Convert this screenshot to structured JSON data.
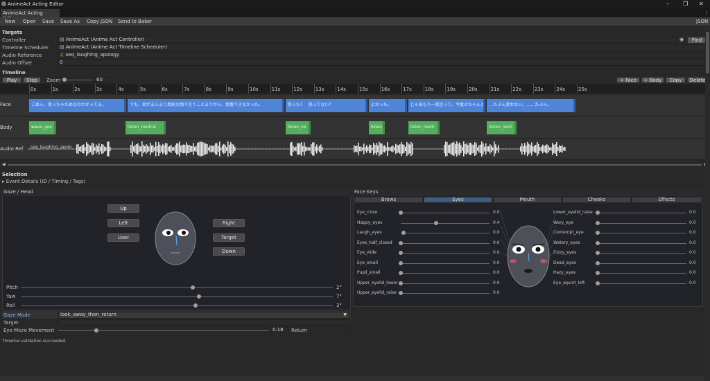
{
  "window": {
    "title": "AnimeAct Acting Editor",
    "tab": "AnimeAct Acting Editor",
    "json_label": "JSON"
  },
  "toolbar": {
    "items": [
      "New",
      "Open",
      "Save",
      "Save As",
      "Copy JSON",
      "Send to Baker"
    ]
  },
  "targets": {
    "header": "Targets",
    "controller_label": "Controller",
    "controller_value": "AnimeAct (Anime Act Controller)",
    "scheduler_label": "Timeline Scheduler",
    "scheduler_value": "AnimeAct (Anime Act Timeline Scheduler)",
    "audio_ref_label": "Audio Reference",
    "audio_ref_value": "seq_laughing_apology",
    "audio_offset_label": "Audio Offset",
    "audio_offset_value": "0",
    "find_label": "Find"
  },
  "timeline": {
    "header": "Timeline",
    "play": "Play",
    "stop": "Stop",
    "zoom_label": "Zoom",
    "zoom_value": "60",
    "zoom_level": 0.1,
    "add_face": "+ Face",
    "add_body": "+ Body",
    "copy": "Copy",
    "delete": "Delete",
    "ticks": [
      "0s",
      "1s",
      "2s",
      "3s",
      "4s",
      "5s",
      "6s",
      "7s",
      "8s",
      "9s",
      "10s",
      "11s",
      "12s",
      "13s",
      "14s",
      "15s",
      "16s",
      "17s",
      "18s",
      "19s",
      "20s",
      "21s",
      "22s",
      "23s",
      "24s",
      "25s"
    ],
    "tracks": {
      "face": "Face",
      "body": "Body",
      "audio": "Audio Ref"
    },
    "face_events": [
      {
        "start": 0.0,
        "end": 4.5,
        "text": "ごめん、笑っちゃだめなのわかってる。"
      },
      {
        "start": 4.5,
        "end": 11.7,
        "text": "でも、君がまんまり真剣な顔で言うことまうから、我慢できなかった。"
      },
      {
        "start": 11.7,
        "end": 15.5,
        "text": "怒った？　怒ってない？"
      },
      {
        "start": 15.5,
        "end": 17.3,
        "text": "よかった。"
      },
      {
        "start": 17.3,
        "end": 20.9,
        "text": "じゃあもう一回言って。今度はちゃんと聞く。"
      },
      {
        "start": 20.9,
        "end": 25.0,
        "text": "…たぶん笑わない。……たぶん。"
      }
    ],
    "body_events": [
      {
        "start": 0.0,
        "end": 1.3,
        "text": "wave_goo"
      },
      {
        "start": 4.4,
        "end": 6.3,
        "text": "listen_neutral"
      },
      {
        "start": 11.7,
        "end": 12.9,
        "text": "listen_ne"
      },
      {
        "start": 15.5,
        "end": 16.3,
        "text": "listen_"
      },
      {
        "start": 17.3,
        "end": 18.8,
        "text": "listen_neutr"
      },
      {
        "start": 20.9,
        "end": 22.3,
        "text": "listen_neut"
      }
    ],
    "audio_clip_label": "seq_laughing_apolo"
  },
  "selection": {
    "header": "Selection",
    "details": "Event Details (ID / Timing / Tags)"
  },
  "gaze": {
    "header": "Gaze / Head",
    "buttons": {
      "up": "Up",
      "left": "Left",
      "user": "User",
      "right": "Right",
      "target": "Target",
      "down": "Down"
    },
    "sliders": [
      {
        "label": "Pitch",
        "value": "2°",
        "pos": 0.55
      },
      {
        "label": "Yaw",
        "value": "7°",
        "pos": 0.57
      },
      {
        "label": "Roll",
        "value": "3°",
        "pos": 0.56
      }
    ],
    "mode_label": "Gaze Mode",
    "mode_value": "look_away_then_return",
    "target_label": "Target",
    "micro_label": "Eye Micro Movement",
    "micro_value": "0.18",
    "micro_pos": 0.18,
    "return_label": "Return"
  },
  "face_keys": {
    "header": "Face Keys",
    "tabs": [
      "Brows",
      "Eyes",
      "Mouth",
      "Cheeks",
      "Effects"
    ],
    "active_tab": "Eyes",
    "left_keys": [
      {
        "name": "Eye_close",
        "value": "0.0",
        "pos": 0.0
      },
      {
        "name": "Happy_eyes",
        "value": "0.4",
        "pos": 0.4
      },
      {
        "name": "Laugh_eyes",
        "value": "0.0",
        "pos": 0.03
      },
      {
        "name": "Eyes_half_closed",
        "value": "0.0",
        "pos": 0.0
      },
      {
        "name": "Eye_wide",
        "value": "0.0",
        "pos": 0.0
      },
      {
        "name": "Eye_small",
        "value": "0.0",
        "pos": 0.0
      },
      {
        "name": "Pupil_small",
        "value": "0.0",
        "pos": 0.0
      },
      {
        "name": "Upper_eyelid_lower",
        "value": "0.0",
        "pos": 0.0
      },
      {
        "name": "Upper_eyelid_raise",
        "value": "0.0",
        "pos": 0.0
      }
    ],
    "right_keys": [
      {
        "name": "Lower_eyelid_raise",
        "value": "0.0",
        "pos": 0.0
      },
      {
        "name": "Wary_eye",
        "value": "0.0",
        "pos": 0.0
      },
      {
        "name": "Contempt_eye",
        "value": "0.0",
        "pos": 0.0
      },
      {
        "name": "Watery_eyes",
        "value": "0.0",
        "pos": 0.0
      },
      {
        "name": "Dizzy_eyes",
        "value": "0.0",
        "pos": 0.0
      },
      {
        "name": "Dead_eyes",
        "value": "0.0",
        "pos": 0.0
      },
      {
        "name": "Hazy_eyes",
        "value": "0.0",
        "pos": 0.0
      },
      {
        "name": "Eye_squint_left",
        "value": "0.0",
        "pos": 0.0
      }
    ]
  },
  "status": {
    "message": "Timeline validation succeeded."
  }
}
